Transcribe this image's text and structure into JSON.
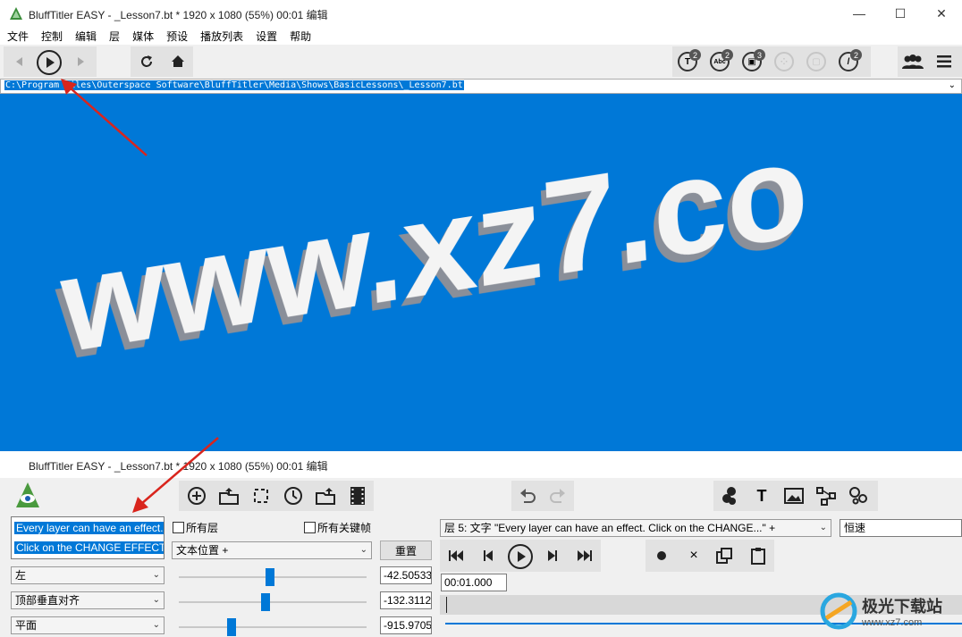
{
  "window": {
    "title": "BluffTitler EASY  - _Lesson7.bt * 1920 x 1080 (55%) 00:01 编辑",
    "minimize": "—",
    "maximize": "☐",
    "close": "✕"
  },
  "menu": [
    "文件",
    "控制",
    "编辑",
    "层",
    "媒体",
    "预设",
    "播放列表",
    "设置",
    "帮助"
  ],
  "toolbar_badges": [
    {
      "icon": "text-layer-icon",
      "glyph": "T",
      "count": "2"
    },
    {
      "icon": "abc-layer-icon",
      "glyph": "Abc",
      "count": "2"
    },
    {
      "icon": "picture-layer-icon",
      "glyph": "▣",
      "count": "3"
    },
    {
      "icon": "particles-icon",
      "glyph": "",
      "count": ""
    },
    {
      "icon": "cube-icon",
      "glyph": "",
      "count": ""
    },
    {
      "icon": "brush-icon",
      "glyph": "/",
      "count": "2"
    }
  ],
  "path": {
    "value": "C:\\Program Files\\Outerspace Software\\BluffTitler\\Media\\Shows\\BasicLessons\\_Lesson7.bt"
  },
  "preview": {
    "text": "www.xz7.co"
  },
  "panel": {
    "title": "BluffTitler EASY  - _Lesson7.bt * 1920 x 1080 (55%) 00:01 编辑",
    "text_line1": "Every layer can have an effect.",
    "text_line2": "Click on the CHANGE EFFECT... bu",
    "all_layers_label": "所有层",
    "all_keyframes_label": "所有关键帧",
    "property_select": "文本位置 +",
    "reset_button": "重置",
    "align_select": "左",
    "valign_select": "顶部垂直对齐",
    "plane_select": "平面",
    "value_x": "-42.505337",
    "value_y": "-132.31127",
    "value_z": "-915.97052",
    "layer_select": "层 5: 文字 \"Every layer can have an effect.  Click on the CHANGE...\" +",
    "speed_select": "恒速",
    "time_value": "00:01.000"
  },
  "watermark": {
    "brand": "极光下载站",
    "url": "www.xz7.com"
  },
  "colors": {
    "preview_bg": "#0078d7",
    "selection": "#0078d7",
    "arrow": "#d9251d"
  }
}
